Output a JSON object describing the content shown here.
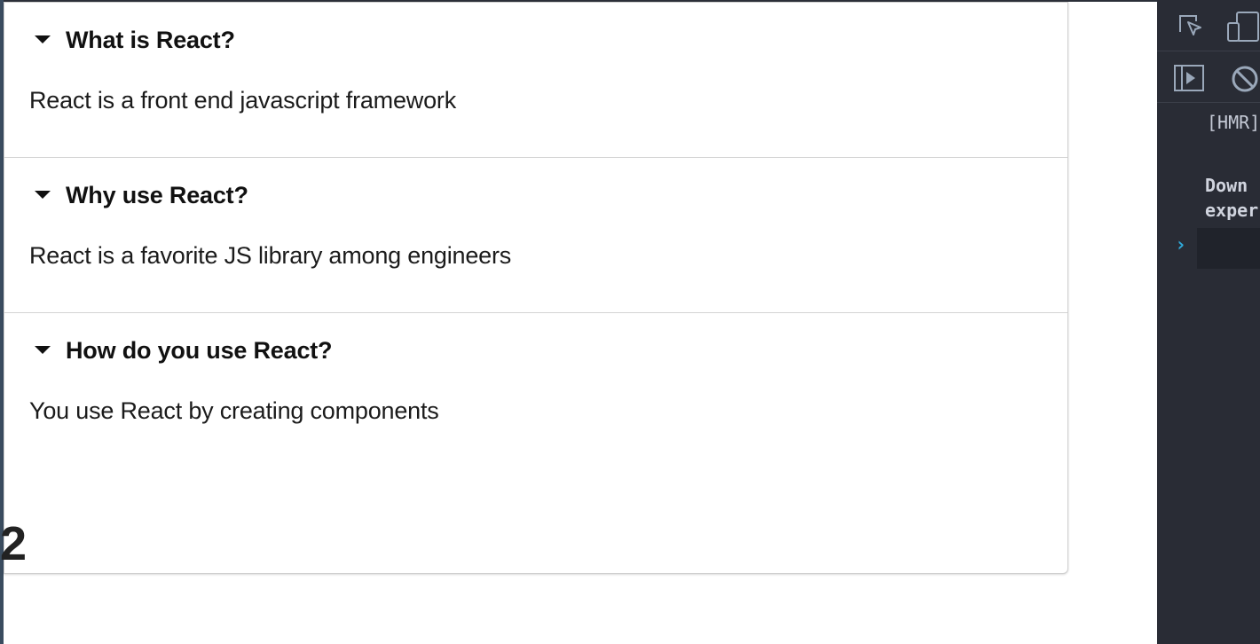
{
  "accordion": {
    "items": [
      {
        "question": "What is React?",
        "answer": "React is a front end javascript framework"
      },
      {
        "question": "Why use React?",
        "answer": "React is a favorite JS library among engineers"
      },
      {
        "question": "How do you use React?",
        "answer": "You use React by creating components"
      }
    ]
  },
  "footer": {
    "number": "2"
  },
  "devtools": {
    "console": {
      "hmr_text": "[HMR]",
      "info_line_1": "Down",
      "info_line_2": "exper"
    },
    "colors": {
      "background": "#292c35",
      "prompt": "#2fa8d8"
    },
    "icons": [
      "inspect-element-icon",
      "device-toggle-icon",
      "sidebar-play-icon",
      "clear-console-icon",
      "chevron-right-icon"
    ]
  }
}
